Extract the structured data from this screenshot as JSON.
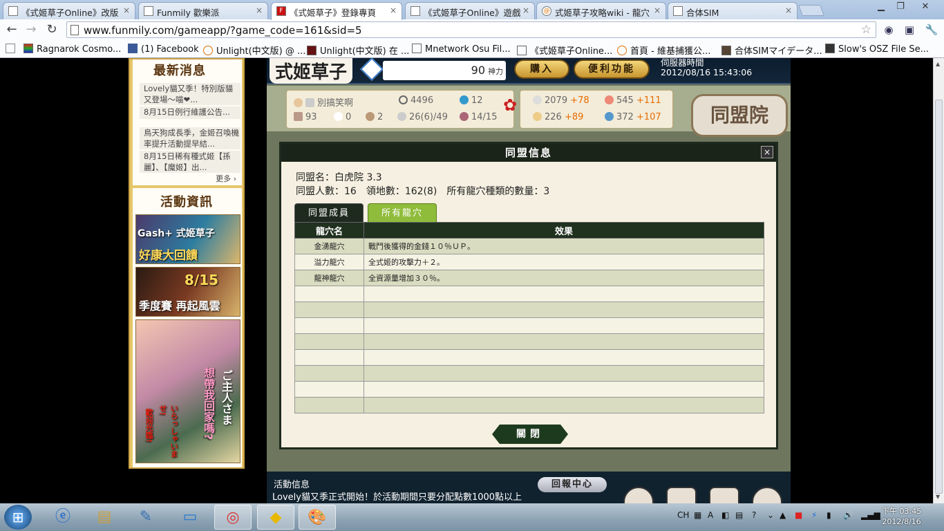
{
  "browser": {
    "tabs": [
      {
        "title": "《式姬草子Online》改版"
      },
      {
        "title": "Funmily 歡樂派"
      },
      {
        "title": "《式姬草子》登錄專頁"
      },
      {
        "title": "《式姬草子Online》遊戲"
      },
      {
        "title": "式姬草子攻略wiki - 龍穴"
      },
      {
        "title": "合体SIM"
      }
    ],
    "url": "www.funmily.com/gameapp/?game_code=161&sid=5",
    "bookmarks": [
      "Ragnarok Cosmo...",
      "(1) Facebook",
      "Unlight(中文版) @ ...",
      "Unlight(中文版) 在 ...",
      "Mnetwork Osu Fil...",
      "《式姬草子Online...",
      "首頁 - 維基捕獲公...",
      "合体SIMマイデータ...",
      "Slow's OSZ File Se..."
    ]
  },
  "sidebar": {
    "news_title": "最新消息",
    "news": [
      "Lovely貓又季！特別版貓又登場～喵❤...",
      "8月15日例行維護公告...",
      "鳥天狗成長季，金姬召喚機率提升活動提早結...",
      "8月15日稀有種式姬【孫麗】、【魔姬】出..."
    ],
    "more": "更多",
    "events_title": "活動資訊",
    "banners": [
      {
        "line1": "Gash+ 式姬草子",
        "line2": "好康大回饋"
      },
      {
        "line1": "8/15",
        "line2": "季度賽 再起風雲"
      },
      {
        "line1": "ご主人さま",
        "line2": "想帶我回家嗎?",
        "line3": "いらっしゃいませ!",
        "line4": "歡迎光臨!"
      }
    ]
  },
  "game": {
    "logo": "式姬草子",
    "power_value": "90",
    "power_unit": "神力",
    "buy_button": "購入",
    "convenience_button": "便利功能",
    "server_time_label": "伺服器時間",
    "server_time": "2012/08/16 15:43:06",
    "player_name": "別搞笑啊",
    "stats": {
      "coins": "4496",
      "water": "12",
      "level": "93",
      "swords": "0",
      "feather": "2",
      "cards": "26(6)/49",
      "girls": "14/15",
      "res1": "2079",
      "res1_plus": "+78",
      "res2": "545",
      "res2_plus": "+111",
      "res3": "226",
      "res3_plus": "+89",
      "res4": "372",
      "res4_plus": "+107"
    },
    "location": "同盟院",
    "activity_label": "活動信息",
    "activity_text": "Lovely貓又季正式開始！於活動期間只要分配點數1000點以上",
    "report_center": "回報中心"
  },
  "dialog": {
    "title": "同盟信息",
    "close_x": "×",
    "alliance_name": "同盟名：白虎院 3.3",
    "alliance_stats": "同盟人數：16　領地數：162(8)　所有龍穴種類的數量：3",
    "tabs": [
      "同盟成員",
      "所有龍穴"
    ],
    "columns": [
      "龍穴名",
      "效果"
    ],
    "rows": [
      {
        "name": "金湧龍穴",
        "effect": "戰鬥後獲得的金錢１０％ＵＰ。"
      },
      {
        "name": "溢力龍穴",
        "effect": "全式姬的攻擊力＋２。"
      },
      {
        "name": "龍神龍穴",
        "effect": "全資源量增加３０％。"
      },
      {
        "name": "",
        "effect": ""
      },
      {
        "name": "",
        "effect": ""
      },
      {
        "name": "",
        "effect": ""
      },
      {
        "name": "",
        "effect": ""
      },
      {
        "name": "",
        "effect": ""
      },
      {
        "name": "",
        "effect": ""
      },
      {
        "name": "",
        "effect": ""
      },
      {
        "name": "",
        "effect": ""
      }
    ],
    "close_button": "關閉"
  },
  "taskbar": {
    "lang": "CH",
    "clock_time": "下午 03:45",
    "clock_date": "2012/8/16"
  }
}
